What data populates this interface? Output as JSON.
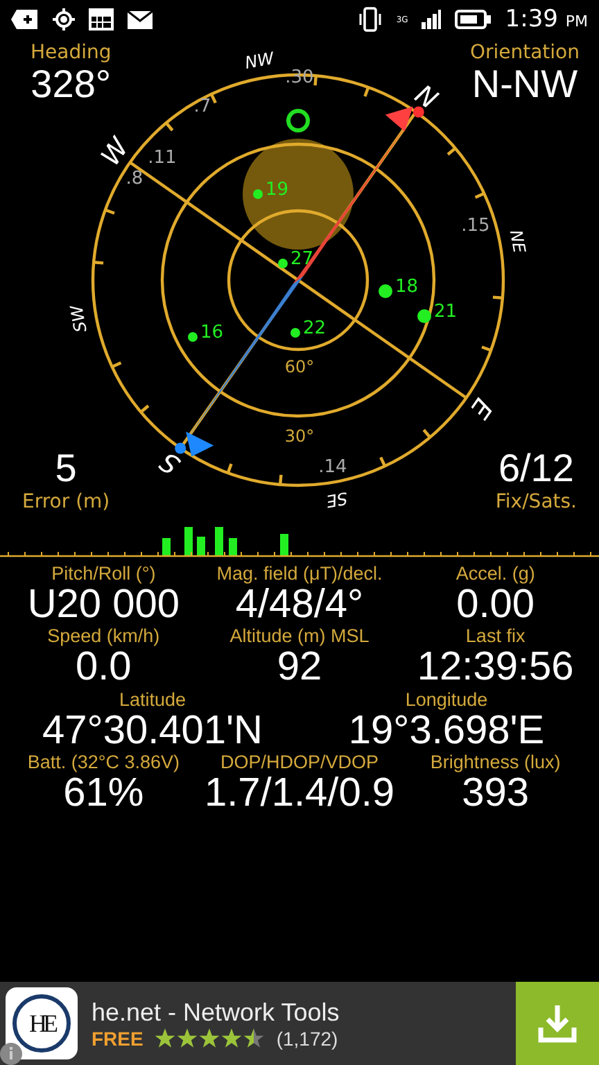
{
  "status_bar": {
    "network": "3G",
    "time": "1:39",
    "ampm": "PM"
  },
  "compass": {
    "heading_label": "Heading",
    "heading": "328°",
    "orientation_label": "Orientation",
    "orientation": "N-NW",
    "error": "5",
    "error_label": "Error (m)",
    "fix": "6/12",
    "fix_label": "Fix/Sats.",
    "directions": [
      {
        "label": "N"
      },
      {
        "label": "NE"
      },
      {
        "label": "E"
      },
      {
        "label": "SE"
      },
      {
        "label": "S"
      },
      {
        "label": "SW"
      },
      {
        "label": "W"
      },
      {
        "label": "NW"
      }
    ],
    "bearing_numbers": [
      {
        "label": ".30"
      },
      {
        "label": ".7"
      },
      {
        "label": ".11"
      },
      {
        "label": ".8"
      },
      {
        "label": ".15"
      },
      {
        "label": ".14"
      }
    ],
    "elevations": [
      {
        "label": "60°"
      },
      {
        "label": "30°"
      }
    ],
    "satellites": [
      {
        "label": "19",
        "kind": "small"
      },
      {
        "label": "27",
        "kind": "small"
      },
      {
        "label": "18",
        "kind": "large"
      },
      {
        "label": "21",
        "kind": "large"
      },
      {
        "label": "16",
        "kind": "small"
      },
      {
        "label": "22",
        "kind": "small"
      }
    ]
  },
  "readings": [
    [
      {
        "label": "Pitch/Roll (°)",
        "value": "U20 000"
      },
      {
        "label": "Mag. field (μT)/decl.",
        "value": "4/48/4°"
      },
      {
        "label": "Accel. (g)",
        "value": "0.00"
      }
    ],
    [
      {
        "label": "Speed (km/h)",
        "value": "0.0"
      },
      {
        "label": "Altitude (m) MSL",
        "value": "92"
      },
      {
        "label": "Last fix",
        "value": "12:39:56"
      }
    ],
    [
      {
        "label": "Latitude",
        "value": "47°30.401'N"
      },
      {
        "label": "Longitude",
        "value": "19°3.698'E"
      }
    ],
    [
      {
        "label": "Batt. (32°C 3.86V)",
        "value": "61%"
      },
      {
        "label": "DOP/HDOP/VDOP",
        "value": "1.7/1.4/0.9"
      },
      {
        "label": "Brightness (lux)",
        "value": "393"
      }
    ]
  ],
  "ad": {
    "logo": "HE",
    "title": "he.net - Network Tools",
    "price": "FREE",
    "stars": 4.5,
    "reviews": "(1,172)"
  }
}
